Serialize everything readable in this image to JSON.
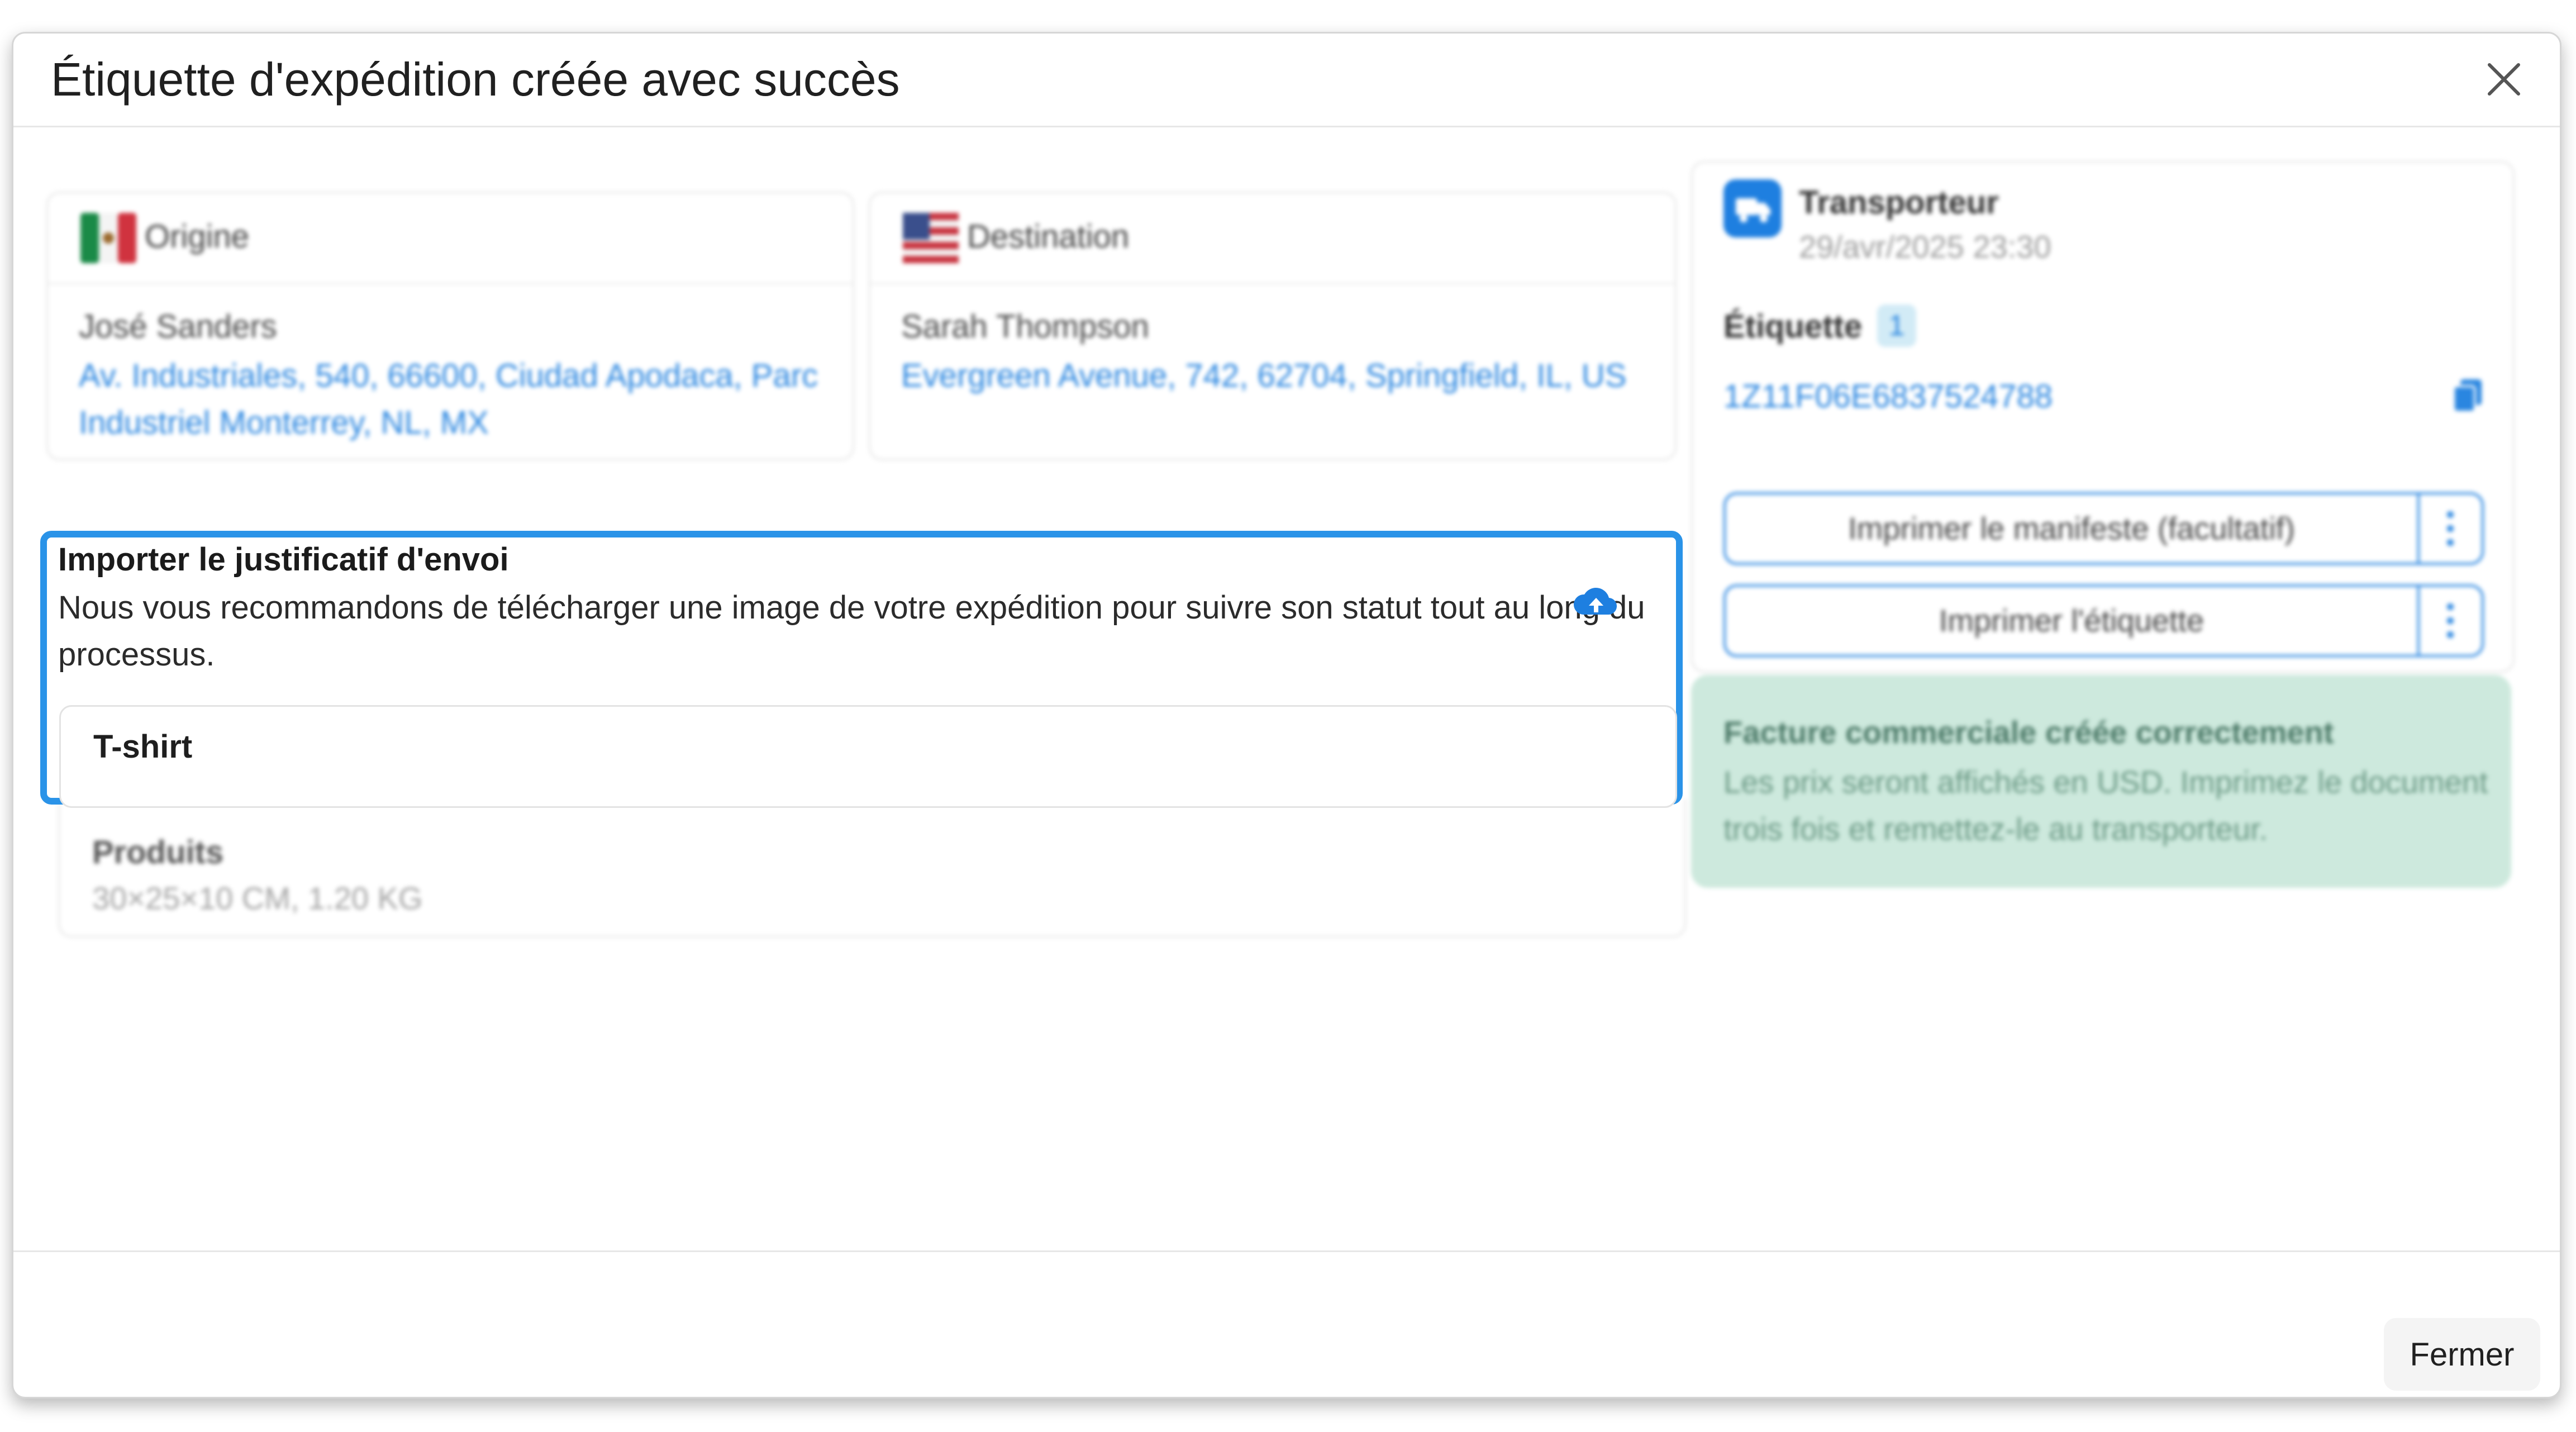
{
  "modal": {
    "title": "Étiquette d'expédition créée avec succès",
    "close_icon": "close-icon"
  },
  "origin": {
    "label": "Origine",
    "flag": "mexico-flag-icon",
    "name": "José Sanders",
    "address": "Av. Industriales, 540, 66600, Ciudad Apodaca, Parc Industriel Monterrey, NL, MX"
  },
  "destination": {
    "label": "Destination",
    "flag": "usa-flag-icon",
    "name": "Sarah Thompson",
    "address": "Evergreen Avenue, 742, 62704, Springfield, IL, US"
  },
  "carrier": {
    "name": "Transporteur",
    "date": "29/avr/2025 23:30",
    "label_title": "Étiquette",
    "label_count": "1",
    "tracking_number": "1Z11F06E6837524788",
    "print_manifest": "Imprimer le manifeste (facultatif)",
    "print_label": "Imprimer l'étiquette"
  },
  "invoice": {
    "title": "Facture commerciale créée correctement",
    "text": "Les prix seront affichés en USD. Imprimez le document trois fois et remettez-le au transporteur."
  },
  "upload": {
    "title": "Importer le justificatif d'envoi",
    "description": "Nous vous recommandons de télécharger une image de votre expédition pour suivre son statut tout au long du processus.",
    "item_name": "T-shirt",
    "upload_icon": "cloud-upload-icon"
  },
  "products": {
    "title": "Produits",
    "dimensions": "30×25×10 CM, 1.20 KG"
  },
  "footer": {
    "close_label": "Fermer"
  },
  "colors": {
    "accent": "#2a86e0",
    "highlight_border": "#2a93e8",
    "success_bg": "#cde9dd",
    "success_text": "#4c7a68"
  }
}
